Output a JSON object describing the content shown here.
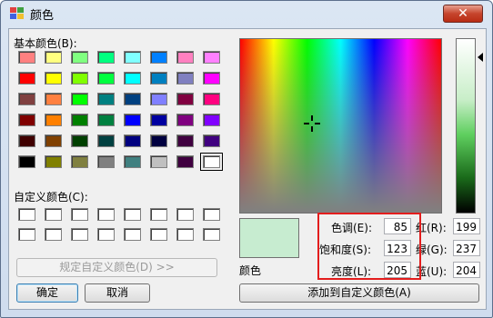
{
  "window": {
    "title": "颜色",
    "close_symbol": "✕"
  },
  "labels": {
    "basic_colors": "基本颜色(B):",
    "custom_colors": "自定义颜色(C):",
    "color_solid": "颜色",
    "hue": "色调(E):",
    "sat": "饱和度(S):",
    "lum": "亮度(L):",
    "red": "红(R):",
    "green": "绿(G):",
    "blue": "蓝(U):"
  },
  "values": {
    "hue": "85",
    "sat": "123",
    "lum": "205",
    "red": "199",
    "green": "237",
    "blue": "204"
  },
  "buttons": {
    "define_custom": "规定自定义颜色(D) >>",
    "ok": "确定",
    "cancel": "取消",
    "add_custom": "添加到自定义颜色(A)"
  },
  "basic_colors": [
    [
      "#ff8080",
      "#ffff80",
      "#80ff80",
      "#00ff80",
      "#80ffff",
      "#0080ff",
      "#ff80c0",
      "#ff80ff"
    ],
    [
      "#ff0000",
      "#ffff00",
      "#80ff00",
      "#00ff40",
      "#00ffff",
      "#0080c0",
      "#8080c0",
      "#ff00ff"
    ],
    [
      "#804040",
      "#ff8040",
      "#00ff00",
      "#008080",
      "#004080",
      "#8080ff",
      "#800040",
      "#ff0080"
    ],
    [
      "#800000",
      "#ff8000",
      "#008000",
      "#008040",
      "#0000ff",
      "#0000a0",
      "#800080",
      "#8000ff"
    ],
    [
      "#400000",
      "#804000",
      "#004000",
      "#004040",
      "#000080",
      "#000040",
      "#400040",
      "#400080"
    ],
    [
      "#000000",
      "#808000",
      "#808040",
      "#808080",
      "#408080",
      "#c0c0c0",
      "#400040",
      "#ffffff"
    ]
  ],
  "selected_color": "#c7edcc",
  "accent_highlight": "#e31d1d"
}
